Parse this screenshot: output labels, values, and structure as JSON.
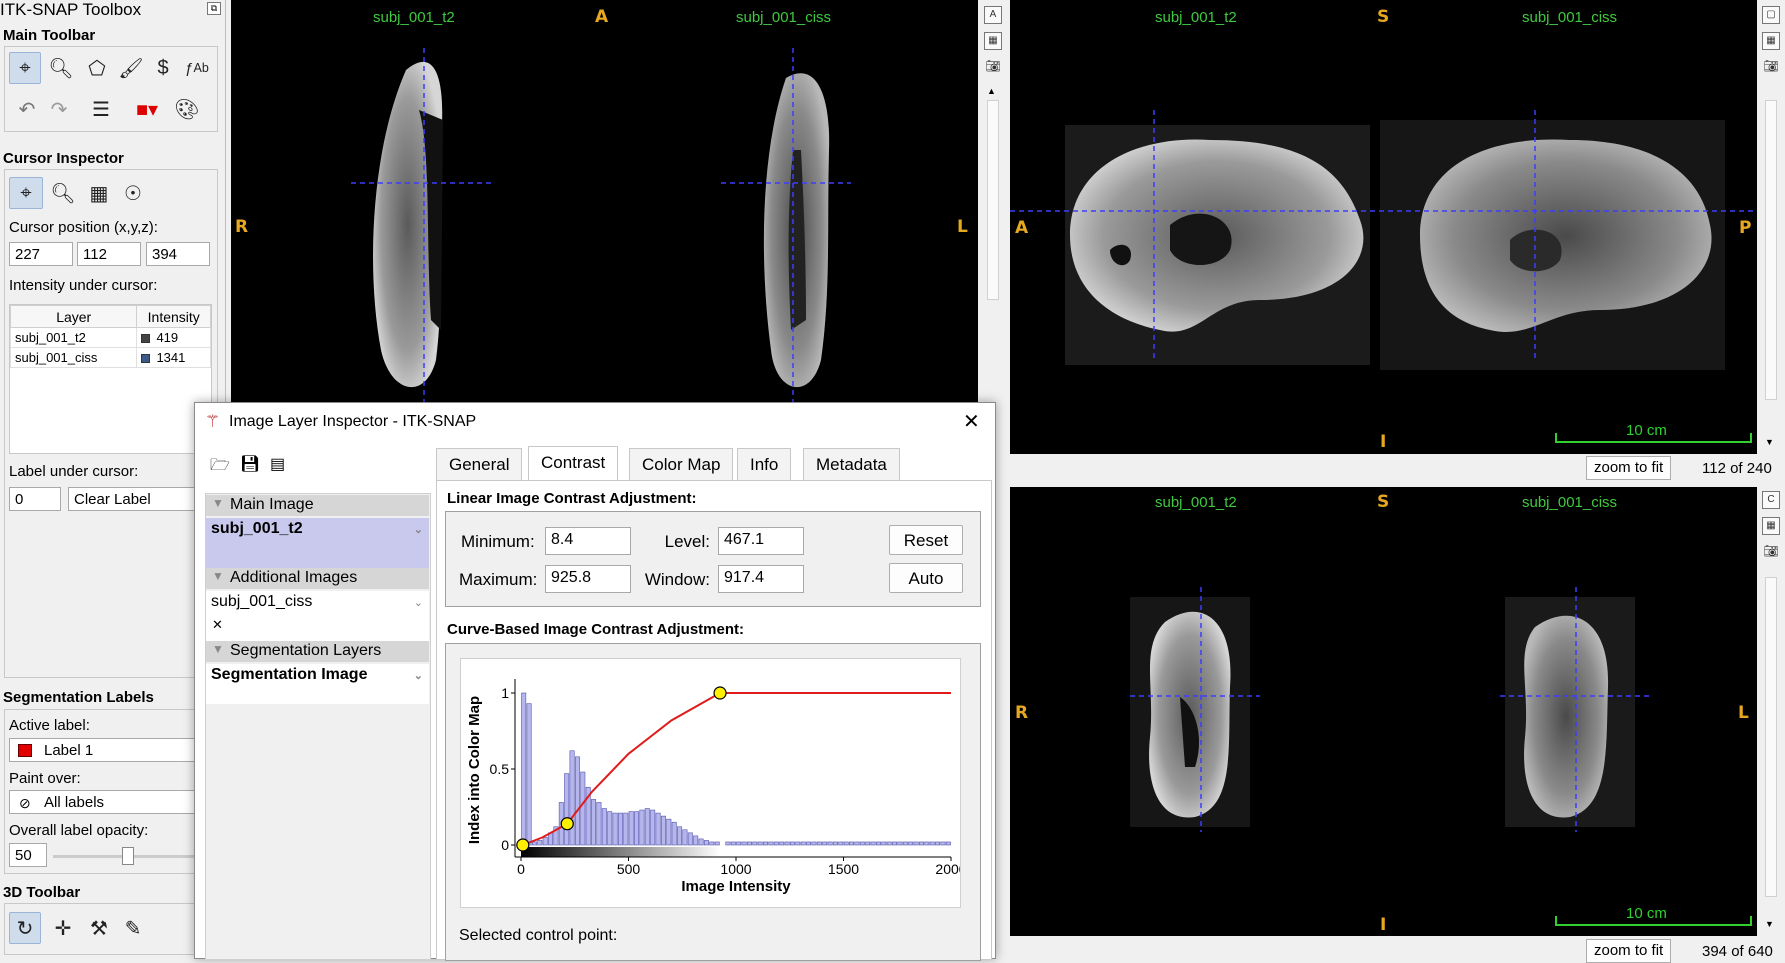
{
  "toolbox": {
    "title": "ITK-SNAP Toolbox",
    "main_toolbar_label": "Main Toolbar",
    "cursor_inspector_label": "Cursor Inspector",
    "cursor_position_label": "Cursor position (x,y,z):",
    "cursor_x": "227",
    "cursor_y": "112",
    "cursor_z": "394",
    "intensity_label": "Intensity under cursor:",
    "table_headers": [
      "Layer",
      "Intensity"
    ],
    "rows": [
      {
        "layer": "subj_001_t2",
        "intensity": "419",
        "color": "#444444"
      },
      {
        "layer": "subj_001_ciss",
        "intensity": "1341",
        "color": "#3b5a8a"
      }
    ],
    "label_under_cursor_label": "Label under cursor:",
    "label_value": "0",
    "label_name": "Clear Label",
    "segmentation_labels_label": "Segmentation Labels",
    "active_label_label": "Active label:",
    "active_label": "Label 1",
    "active_label_color": "#e10000",
    "paint_over_label": "Paint over:",
    "paint_over": "All labels",
    "opacity_label": "Overall label opacity:",
    "opacity_value": "50",
    "opacity_fraction": 0.5,
    "toolbar_3d_label": "3D Toolbar"
  },
  "views": {
    "top_left": {
      "title_a": "subj_001_t2",
      "title_b": "subj_001_ciss",
      "top": "A",
      "left": "R",
      "right": "L"
    },
    "top_right": {
      "title_a": "subj_001_t2",
      "title_b": "subj_001_ciss",
      "top": "S",
      "left": "A",
      "right": "P",
      "bottom": "I",
      "scale": "10 cm",
      "zoom": "zoom to fit",
      "slice": "112 of 240"
    },
    "bottom_right": {
      "title_a": "subj_001_t2",
      "title_b": "subj_001_ciss",
      "top": "S",
      "left": "R",
      "right": "L",
      "bottom": "I",
      "scale": "10 cm",
      "zoom": "zoom to fit",
      "slice": "394 of 640"
    }
  },
  "dialog": {
    "title": "Image Layer Inspector - ITK-SNAP",
    "close": "✕",
    "tabs": [
      "General",
      "Contrast",
      "Color Map",
      "Info",
      "Metadata"
    ],
    "selected_tab": "Contrast",
    "tree": {
      "main_header": "Main Image",
      "main_item": "subj_001_t2",
      "additional_header": "Additional Images",
      "additional_item": "subj_001_ciss",
      "seg_header": "Segmentation Layers",
      "seg_item": "Segmentation Image"
    },
    "linear": {
      "heading": "Linear Image Contrast Adjustment:",
      "minimum_label": "Minimum:",
      "minimum": "8.4",
      "maximum_label": "Maximum:",
      "maximum": "925.8",
      "level_label": "Level:",
      "level": "467.1",
      "window_label": "Window:",
      "window": "917.4",
      "reset": "Reset",
      "auto": "Auto"
    },
    "curve_heading": "Curve-Based Image Contrast Adjustment:",
    "selected_point_label": "Selected control point:"
  },
  "chart_data": {
    "type": "line",
    "xlabel": "Image Intensity",
    "ylabel": "Index into Color Map",
    "xlim": [
      0,
      2000
    ],
    "ylim": [
      0,
      1
    ],
    "x_ticks": [
      "0",
      "500",
      "1000",
      "1500",
      "2000"
    ],
    "y_ticks": [
      "0",
      "0.5",
      "1"
    ],
    "curve": {
      "x": [
        8.4,
        100,
        215,
        330,
        500,
        700,
        925.8,
        2000
      ],
      "y": [
        0,
        0.05,
        0.14,
        0.35,
        0.6,
        0.82,
        1,
        1
      ]
    },
    "control_points": {
      "x": [
        8.4,
        215,
        925.8
      ],
      "y": [
        0,
        0.14,
        1
      ]
    },
    "histogram": {
      "bin_starts": [
        0,
        25,
        50,
        75,
        100,
        125,
        150,
        175,
        200,
        225,
        250,
        275,
        300,
        325,
        350,
        375,
        400,
        425,
        450,
        475,
        500,
        525,
        550,
        575,
        600,
        625,
        650,
        675,
        700,
        725,
        750,
        775,
        800,
        825,
        850,
        875,
        900
      ],
      "values": [
        1,
        0.93,
        0.02,
        0.03,
        0.05,
        0.08,
        0.12,
        0.28,
        0.47,
        0.62,
        0.58,
        0.48,
        0.38,
        0.3,
        0.28,
        0.24,
        0.22,
        0.21,
        0.21,
        0.21,
        0.22,
        0.22,
        0.23,
        0.24,
        0.23,
        0.21,
        0.19,
        0.17,
        0.15,
        0.12,
        0.1,
        0.08,
        0.06,
        0.04,
        0.03,
        0.02,
        0.02
      ],
      "tail_value": 0.02
    },
    "line_color": "#e01b1b",
    "bar_color": "#b6b6ee",
    "point_color": "#ffef00"
  }
}
